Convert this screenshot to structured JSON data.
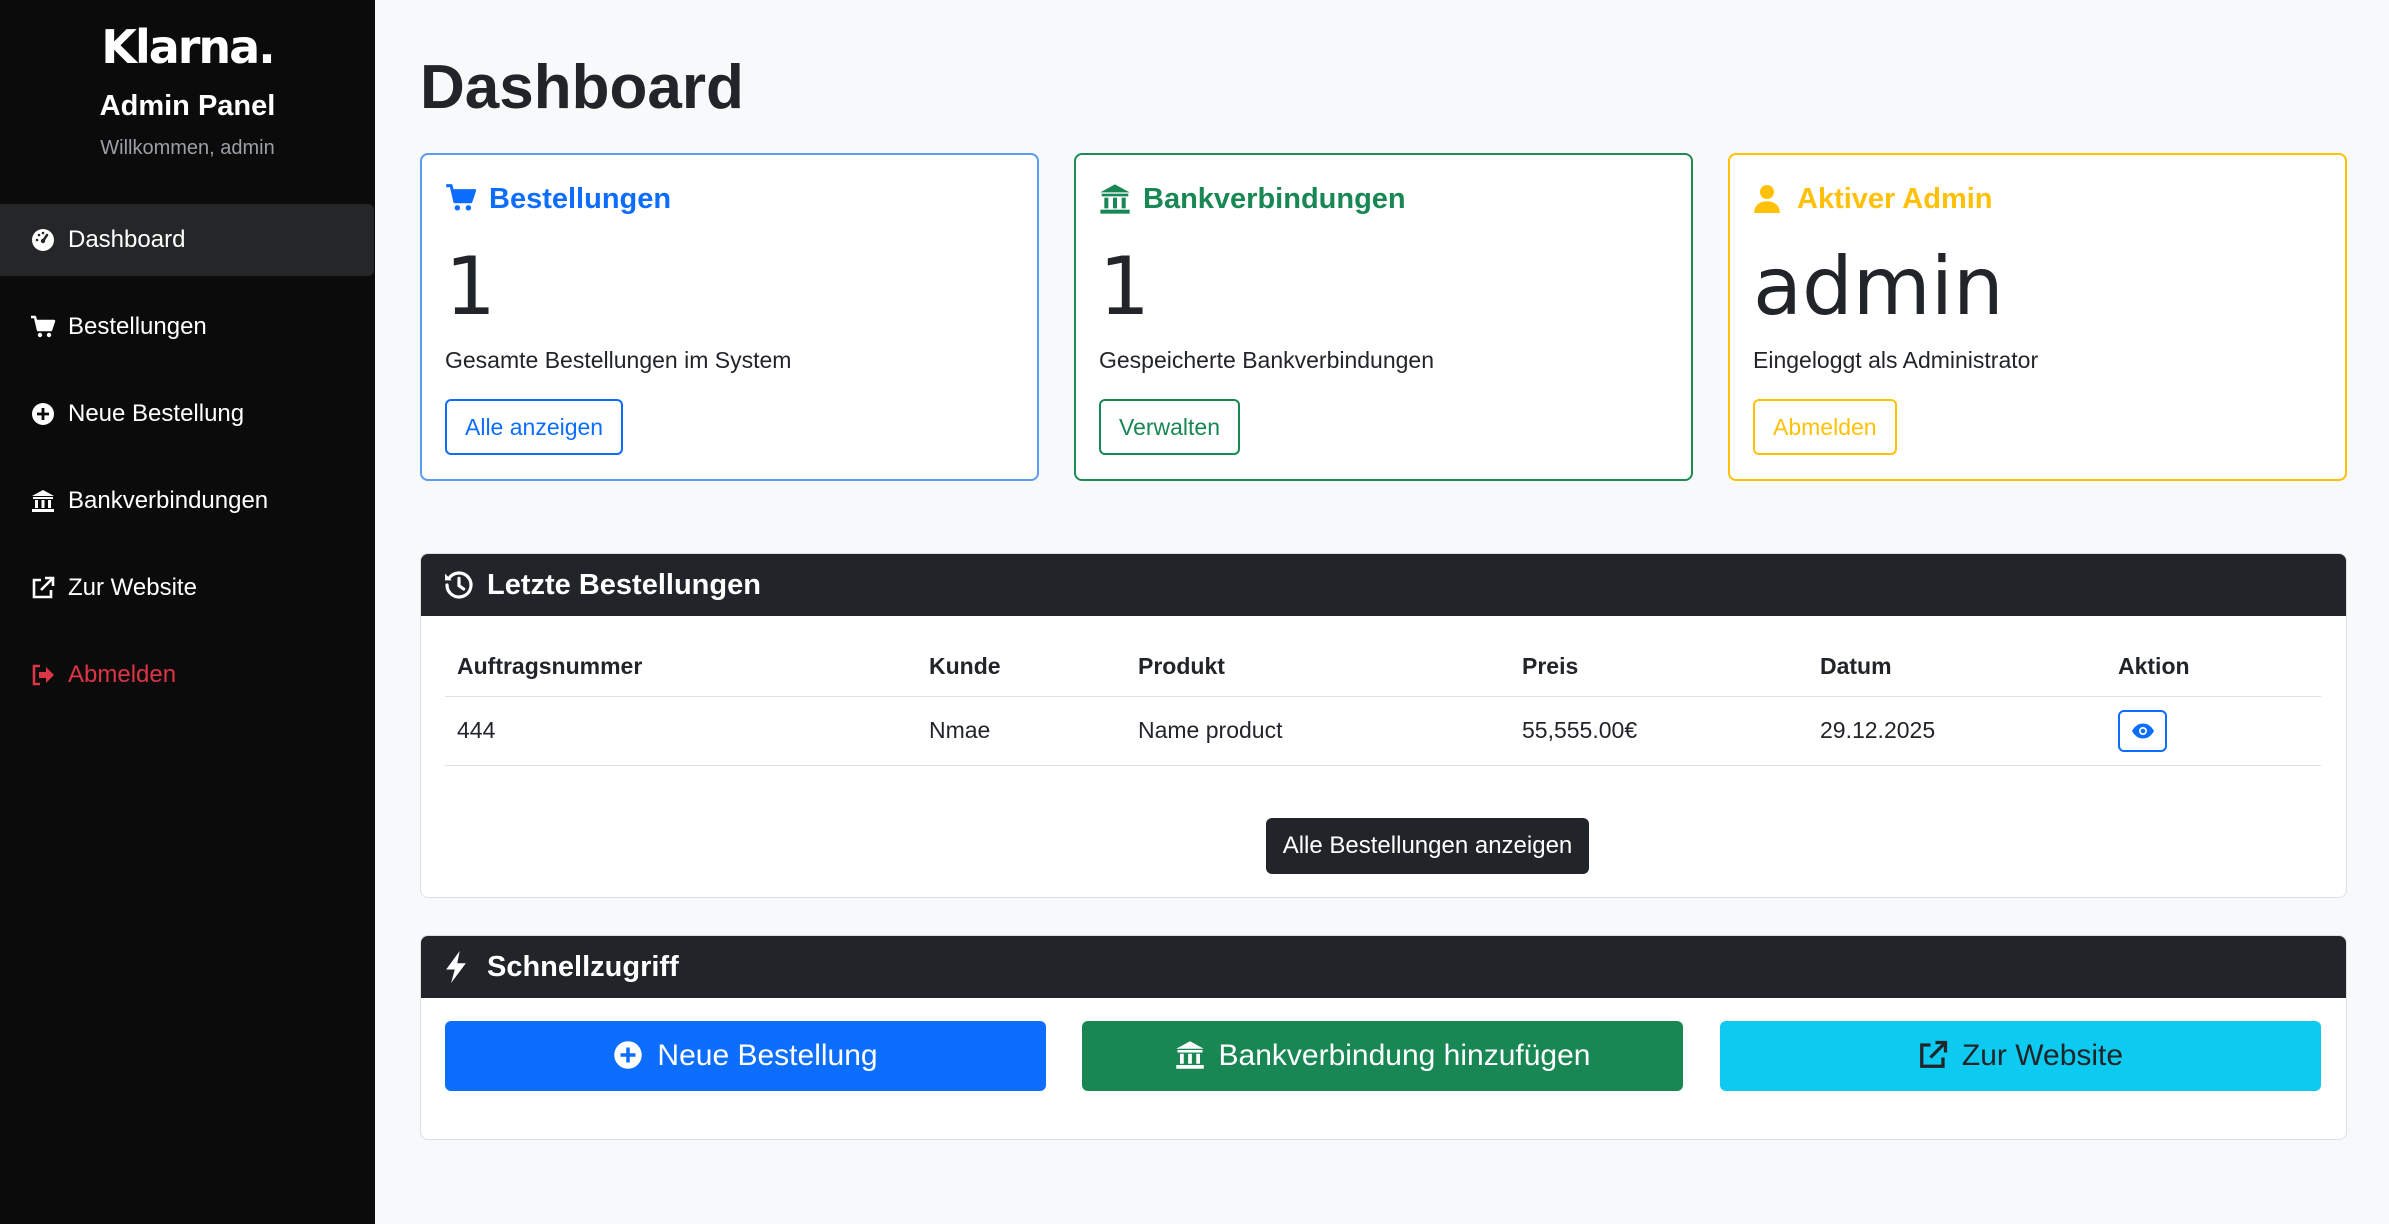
{
  "sidebar": {
    "logo": "Klarna.",
    "title": "Admin Panel",
    "welcome": "Willkommen, admin",
    "items": [
      {
        "label": "Dashboard",
        "icon": "gauge-icon"
      },
      {
        "label": "Bestellungen",
        "icon": "cart-icon"
      },
      {
        "label": "Neue Bestellung",
        "icon": "plus-circle-icon"
      },
      {
        "label": "Bankverbindungen",
        "icon": "bank-icon"
      },
      {
        "label": "Zur Website",
        "icon": "external-link-icon"
      },
      {
        "label": "Abmelden",
        "icon": "logout-icon"
      }
    ]
  },
  "page": {
    "title": "Dashboard"
  },
  "cards": {
    "orders": {
      "title": "Bestellungen",
      "value": "1",
      "text": "Gesamte Bestellungen im System",
      "button": "Alle anzeigen",
      "color": "#0d6efd"
    },
    "banks": {
      "title": "Bankverbindungen",
      "value": "1",
      "text": "Gespeicherte Bankverbindungen",
      "button": "Verwalten",
      "color": "#198754"
    },
    "admin": {
      "title": "Aktiver Admin",
      "value": "admin",
      "text": "Eingeloggt als Administrator",
      "button": "Abmelden",
      "color": "#ffc107"
    }
  },
  "recent": {
    "title": "Letzte Bestellungen",
    "columns": [
      "Auftragsnummer",
      "Kunde",
      "Produkt",
      "Preis",
      "Datum",
      "Aktion"
    ],
    "rows": [
      {
        "order": "444",
        "customer": "Nmae",
        "product": "Name product",
        "price": "55,555.00€",
        "date": "29.12.2025"
      }
    ],
    "all_button": "Alle Bestellungen anzeigen"
  },
  "quick": {
    "title": "Schnellzugriff",
    "new_order": "Neue Bestellung",
    "add_bank": "Bankverbindung hinzufügen",
    "website": "Zur Website"
  }
}
